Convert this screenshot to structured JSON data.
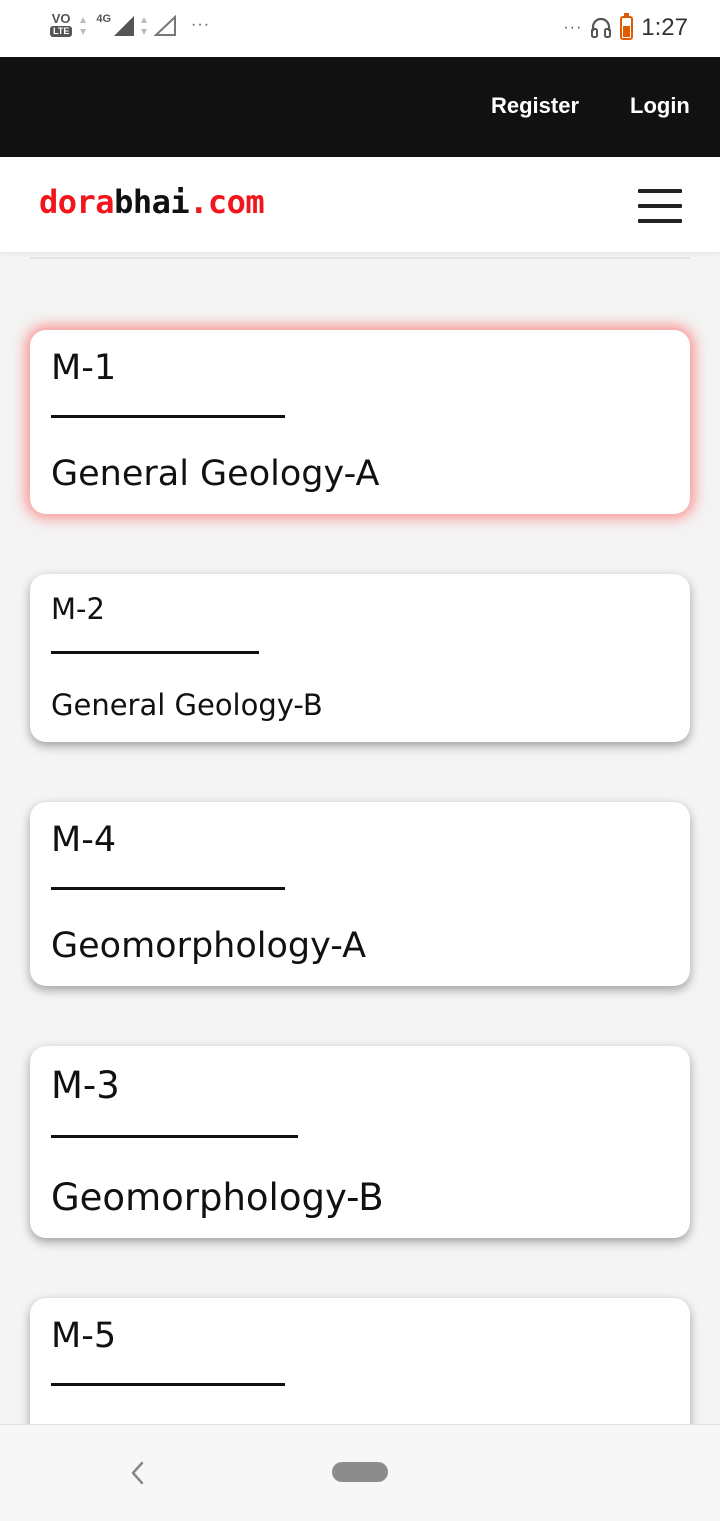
{
  "status_bar": {
    "volte_top": "VO",
    "volte_bottom": "LTE",
    "network_type": "4G",
    "more_left": "···",
    "more_right": "···",
    "time": "1:27"
  },
  "header": {
    "register_label": "Register",
    "login_label": "Login"
  },
  "brand": {
    "part1": "dora",
    "part2": "bhai",
    "part3": ".com",
    "color_red": "#f0161b",
    "color_dark": "#111111"
  },
  "cards": [
    {
      "code": "M-1",
      "title": "General Geology-A"
    },
    {
      "code": "M-2",
      "title": "General Geology-B"
    },
    {
      "code": "M-4",
      "title": "Geomorphology-A"
    },
    {
      "code": "M-3",
      "title": "Geomorphology-B"
    },
    {
      "code": "M-5",
      "title": ""
    }
  ]
}
